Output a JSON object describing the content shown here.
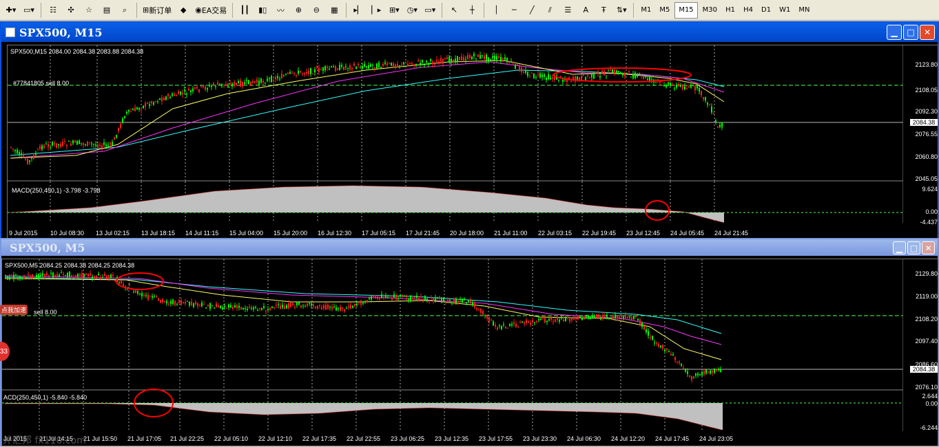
{
  "toolbar": {
    "new_order": "新订单",
    "ea_trading": "EA交易",
    "timeframes": [
      "M1",
      "M5",
      "M15",
      "M30",
      "H1",
      "H4",
      "D1",
      "W1",
      "MN"
    ],
    "active_timeframe": "M15"
  },
  "window1": {
    "title": "SPX500, M15",
    "header": "SPX500,M15  2084.00 2084.38 2083.88 2084.38",
    "order_label": "#77841805 sell 8.00",
    "macd_label": "MACD(250,450,1) -3.798 -3.798",
    "y_labels": [
      "2123.80",
      "2108.05",
      "2092.30",
      "2084.38",
      "2076.55",
      "2060.80",
      "2045.05"
    ],
    "macd_y_labels": [
      "9.624",
      "0.00",
      "-4.437"
    ],
    "x_labels": [
      "9 Jul 2015",
      "10 Jul 08:30",
      "13 Jul 02:15",
      "13 Jul 18:15",
      "14 Jul 11:15",
      "15 Jul 04:00",
      "15 Jul 20:00",
      "16 Jul 12:30",
      "17 Jul 05:15",
      "17 Jul 21:45",
      "20 Jul 18:00",
      "21 Jul 11:00",
      "22 Jul 03:15",
      "22 Jul 19:45",
      "23 Jul 12:45",
      "24 Jul 05:45",
      "24 Jul 21:45"
    ]
  },
  "window2": {
    "title": "SPX500, M5",
    "header": "SPX500,M5  2084.25 2084.38 2084.25 2084.38",
    "order_label": "sell 8.00",
    "macd_label": "ACD(250,450,1) -5.840 -5.840",
    "y_labels": [
      "2129.80",
      "2119.00",
      "2108.20",
      "2097.40",
      "2086.60",
      "2084.38",
      "2076.10"
    ],
    "macd_y_labels": [
      "2.644",
      "0.00",
      "-6.244"
    ],
    "x_labels": [
      "Jul 2015",
      "21 Jul 14:15",
      "21 Jul 15:50",
      "21 Jul 17:05",
      "21 Jul 22:25",
      "22 Jul 05:10",
      "22 Jul 12:10",
      "22 Jul 17:35",
      "22 Jul 22:55",
      "23 Jul 06:25",
      "23 Jul 12:35",
      "23 Jul 17:55",
      "23 Jul 23:30",
      "24 Jul 06:30",
      "24 Jul 12:20",
      "24 Jul 17:45",
      "24 Jul 23:05"
    ]
  },
  "overlay": {
    "ad_badge": "点我加速",
    "ad_count": "33",
    "watermark": "外汇邦 fx110.com"
  },
  "colors": {
    "bull": "#00ff00",
    "bear": "#ff2020",
    "ma_fast": "#ffff66",
    "ma_mid": "#ff33ff",
    "ma_slow": "#33ffff",
    "annotation": "#ff0000"
  }
}
